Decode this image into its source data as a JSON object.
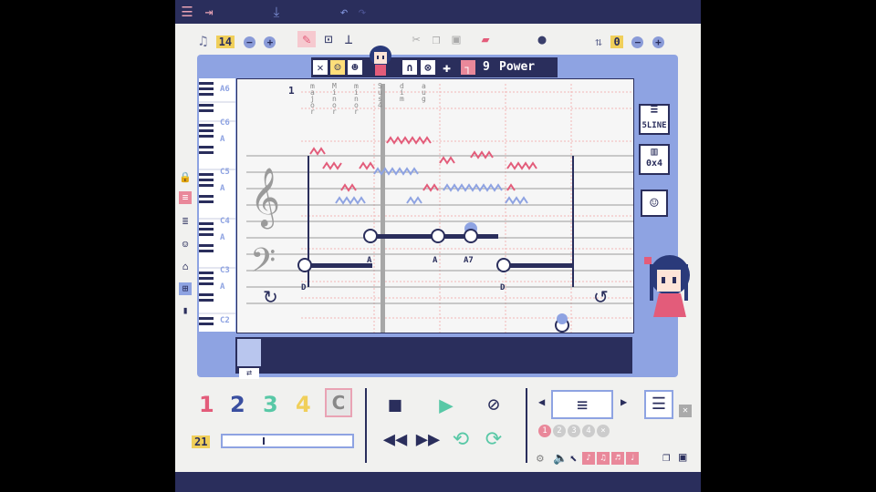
{
  "colors": {
    "navy": "#2a2e5c",
    "pink": "#e35c7a",
    "periwinkle": "#8ea3e2",
    "yellow": "#f0cf5a",
    "teal": "#58c8a6",
    "bg": "#f1f1ef"
  },
  "toolbar": {
    "icons": [
      "menu-icon",
      "export-icon",
      "download-icon",
      "undo-icon",
      "redo-icon"
    ]
  },
  "header": {
    "tempo": "14",
    "key_shift": "0"
  },
  "chord_bar": {
    "chord_number": "9",
    "chord_name": "Power"
  },
  "measure": {
    "number": "1"
  },
  "scale_rows": [
    "A6",
    "C6",
    "A",
    "C5",
    "A",
    "C4",
    "A",
    "C3",
    "A",
    "C2"
  ],
  "chord_columns": [
    [
      "m",
      "a",
      "j",
      "o",
      "r"
    ],
    [
      "M",
      "i",
      "n",
      "o",
      "r"
    ],
    [
      "m",
      "i",
      "n",
      "o",
      "r"
    ],
    [
      "S",
      "u",
      "s",
      "4"
    ],
    [
      "d",
      "i",
      "m"
    ],
    [
      "a",
      "u",
      "g"
    ]
  ],
  "chords": {
    "first": "A",
    "second": "A",
    "third": "A7",
    "bass1": "D",
    "bass2": "D"
  },
  "right_panel": {
    "staff_mode": "5LINE",
    "grid_mode": "0x4"
  },
  "tracks": {
    "t1": "1",
    "t2": "2",
    "t3": "3",
    "t4": "4",
    "tc": "C"
  },
  "position": {
    "bar": "21"
  },
  "transport": {
    "stop": "■",
    "play": "▶"
  }
}
